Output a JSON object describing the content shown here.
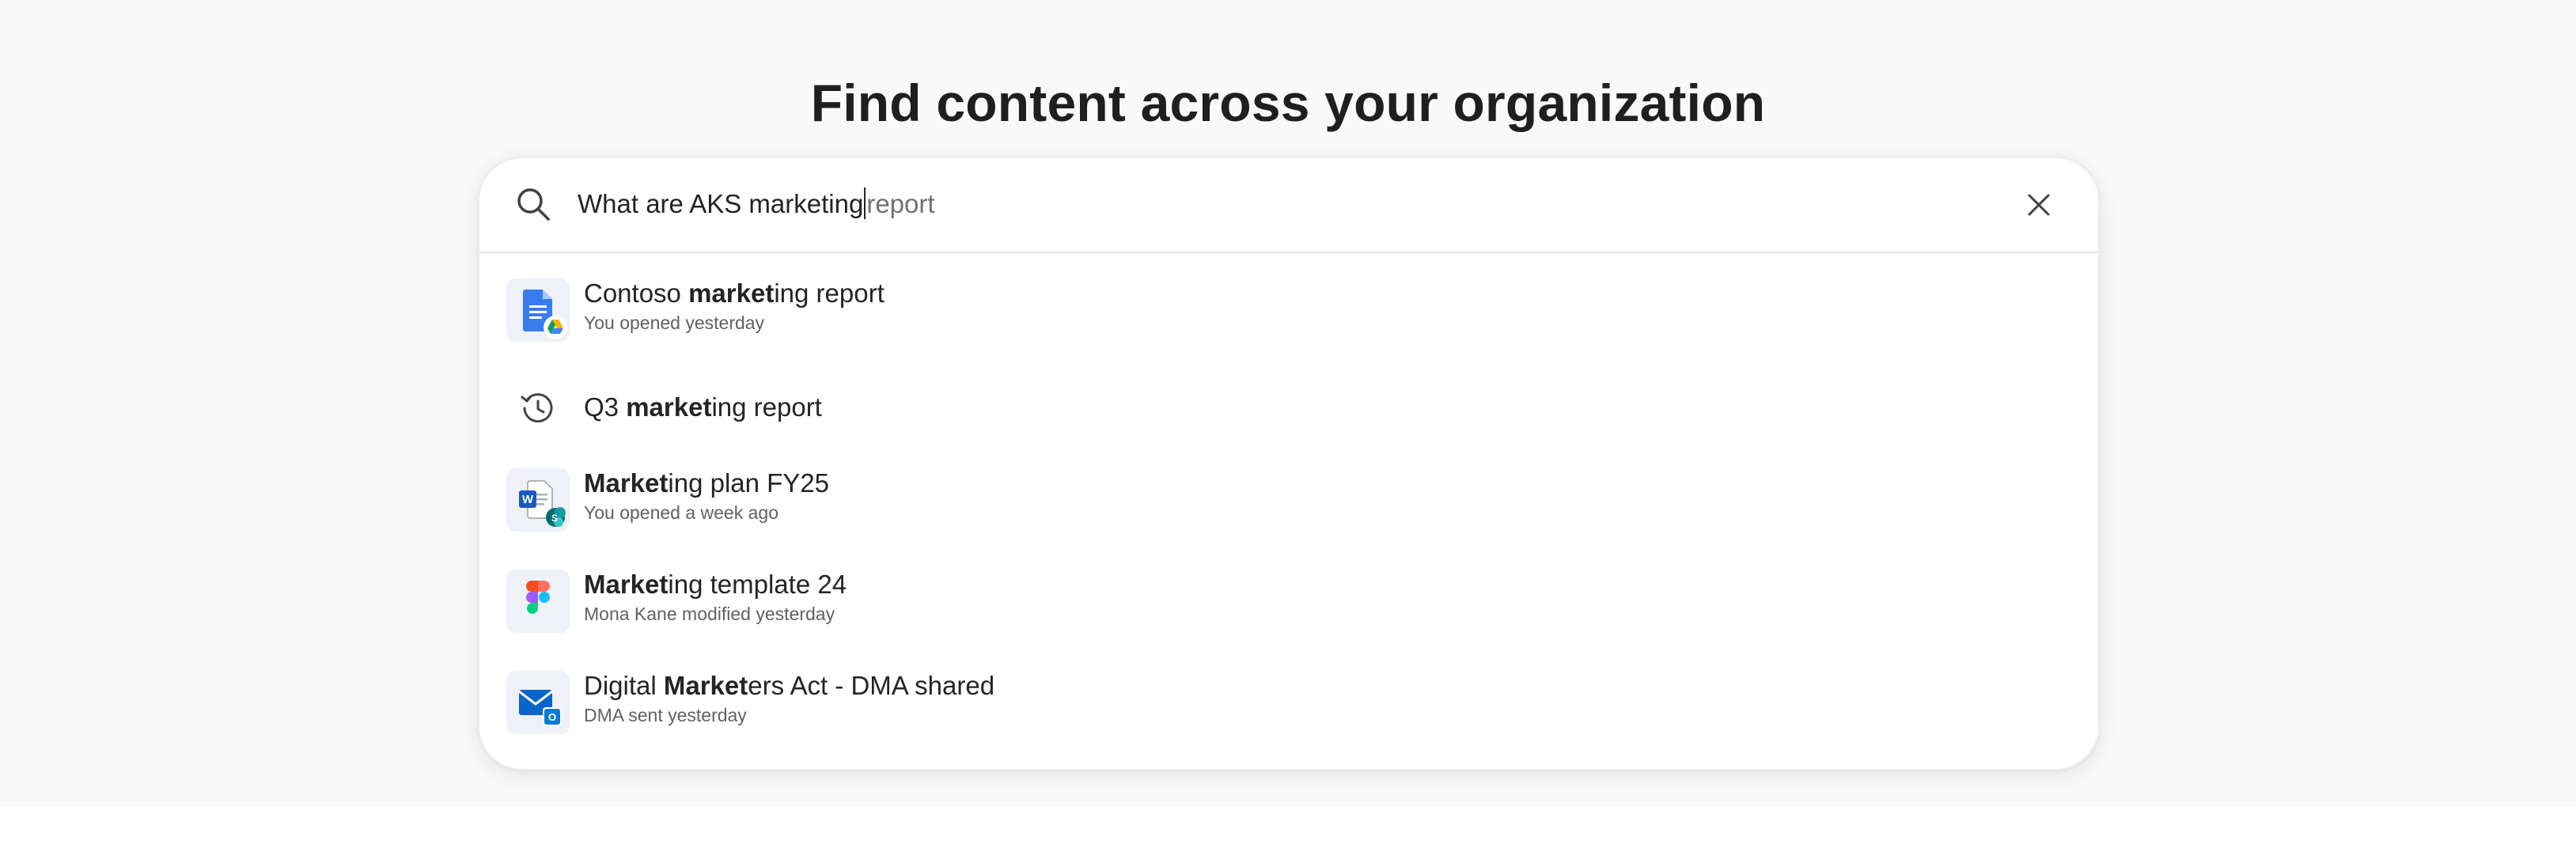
{
  "page": {
    "title": "Find content across your organization"
  },
  "search": {
    "typed_text": "What are AKS marketing",
    "suggestion_text": "report",
    "clear_label": "close-icon"
  },
  "results": [
    {
      "icon": "google-docs-drive-icon",
      "title_prefix": "Contoso ",
      "title_match": "market",
      "title_suffix": "ing report",
      "subtitle": "You opened yesterday"
    },
    {
      "icon": "history-icon",
      "title_prefix": "Q3 ",
      "title_match": "market",
      "title_suffix": "ing report",
      "subtitle": ""
    },
    {
      "icon": "word-sharepoint-icon",
      "title_prefix": "",
      "title_match": "Market",
      "title_suffix": "ing plan FY25",
      "subtitle": "You opened a week ago"
    },
    {
      "icon": "figma-icon",
      "title_prefix": "",
      "title_match": "Market",
      "title_suffix": "ing template 24",
      "subtitle": "Mona Kane modified yesterday"
    },
    {
      "icon": "outlook-mail-icon",
      "title_prefix": "Digital ",
      "title_match": "Market",
      "title_suffix": "ers Act - DMA shared",
      "subtitle": "DMA sent yesterday"
    }
  ],
  "colors": {
    "background": "#f9f9f9",
    "card": "#ffffff",
    "text": "#242424",
    "secondary_text": "#616161",
    "ghost_text": "#707070"
  }
}
